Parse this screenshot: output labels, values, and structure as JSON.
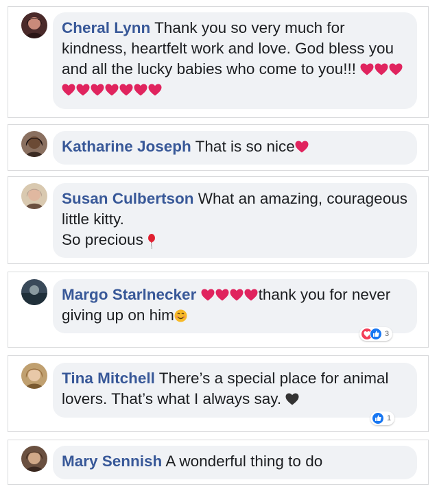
{
  "comments": [
    {
      "name": "Cheral Lynn",
      "text": "Thank you so very much for kindness, heartfelt work and love. God bless you and all the lucky babies who come to you!!!",
      "emoji": "red-heart x10"
    },
    {
      "name": "Katharine Joseph",
      "text": "That is so nice",
      "emoji": "red-heart"
    },
    {
      "name": "Susan Culbertson",
      "text_line1": "What an amazing, courageous little kitty.",
      "text_line2": "So precious",
      "emoji": "balloon"
    },
    {
      "name": "Margo Starlnecker",
      "text": "thank you for never giving up on him",
      "emoji": "red-heart x4, smiling-face",
      "reaction_count": "3"
    },
    {
      "name": "Tina Mitchell",
      "text": "There’s a special place for animal lovers. That’s what I always say.",
      "emoji": "black-heart",
      "reaction_count": "1"
    },
    {
      "name": "Mary Sennish",
      "text": "A wonderful thing to do"
    }
  ],
  "colors": {
    "name": "#385898",
    "bubble": "#f0f2f5",
    "text": "#1c1e21",
    "heart": "#e0245e",
    "like": "#1877f2",
    "love": "#f33e58"
  }
}
